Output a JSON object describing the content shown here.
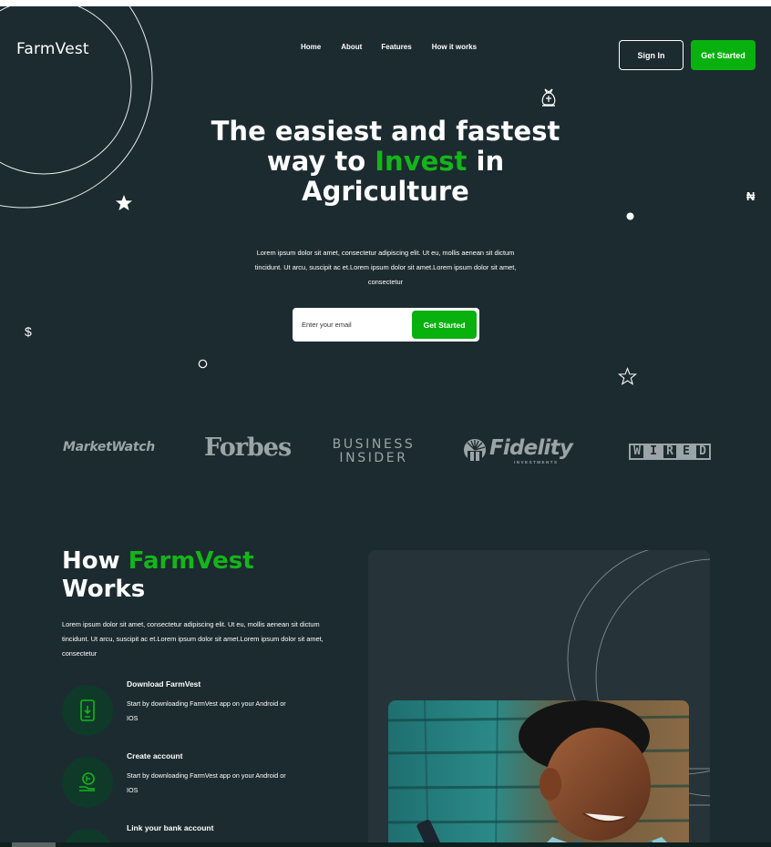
{
  "brand": {
    "logo": "FarmVest"
  },
  "nav": {
    "items": [
      "Home",
      "About",
      "Features",
      "How it works"
    ]
  },
  "header": {
    "signin_label": "Sign In",
    "get_started_label": "Get Started"
  },
  "hero": {
    "title_line1": "The easiest and fastest",
    "title_line2_pre": "way to ",
    "title_line2_accent": "Invest",
    "title_line2_post": " in",
    "title_line3": "Agriculture",
    "description": "Lorem ipsum dolor sit amet, consectetur adipiscing elit. Ut eu, mollis aenean sit dictum tincidunt. Ut arcu, suscipit ac et.Lorem ipsum dolor sit amet.Lorem ipsum dolor sit amet, consectetur",
    "email_placeholder": "Enter your email",
    "cta_label": "Get Started"
  },
  "decorations": {
    "dollar": "$",
    "naira": "₦"
  },
  "press": {
    "marketwatch": "MarketWatch",
    "forbes": "Forbes",
    "business_insider_line1": "BUSINESS",
    "business_insider_line2": "INSIDER",
    "fidelity": "Fidelity",
    "fidelity_sub": "INVESTMENTS",
    "wired": [
      "W",
      "I",
      "R",
      "E",
      "D"
    ]
  },
  "how": {
    "title_pre": "How ",
    "title_accent": "FarmVest",
    "title_line2": "Works",
    "description": "Lorem ipsum dolor sit amet, consectetur adipiscing elit. Ut eu, mollis aenean sit dictum tincidunt. Ut arcu, suscipit ac et.Lorem ipsum dolor sit amet.Lorem ipsum dolor sit amet, consectetur",
    "steps": [
      {
        "title": "Download FarmVest",
        "description": "Start by downloading FarmVest app on your Android or IOS",
        "icon": "phone-download-icon"
      },
      {
        "title": "Create account",
        "description": "Start by downloading FarmVest app on your Android or IOS",
        "icon": "coins-hand-icon"
      },
      {
        "title": "Link your bank account",
        "description": "",
        "icon": "bank-icon"
      }
    ]
  },
  "colors": {
    "background": "#1c2b30",
    "accent": "#09b10e",
    "accent_text": "#14b51a",
    "card": "#263338",
    "press_logo": "#9ba4a6"
  }
}
